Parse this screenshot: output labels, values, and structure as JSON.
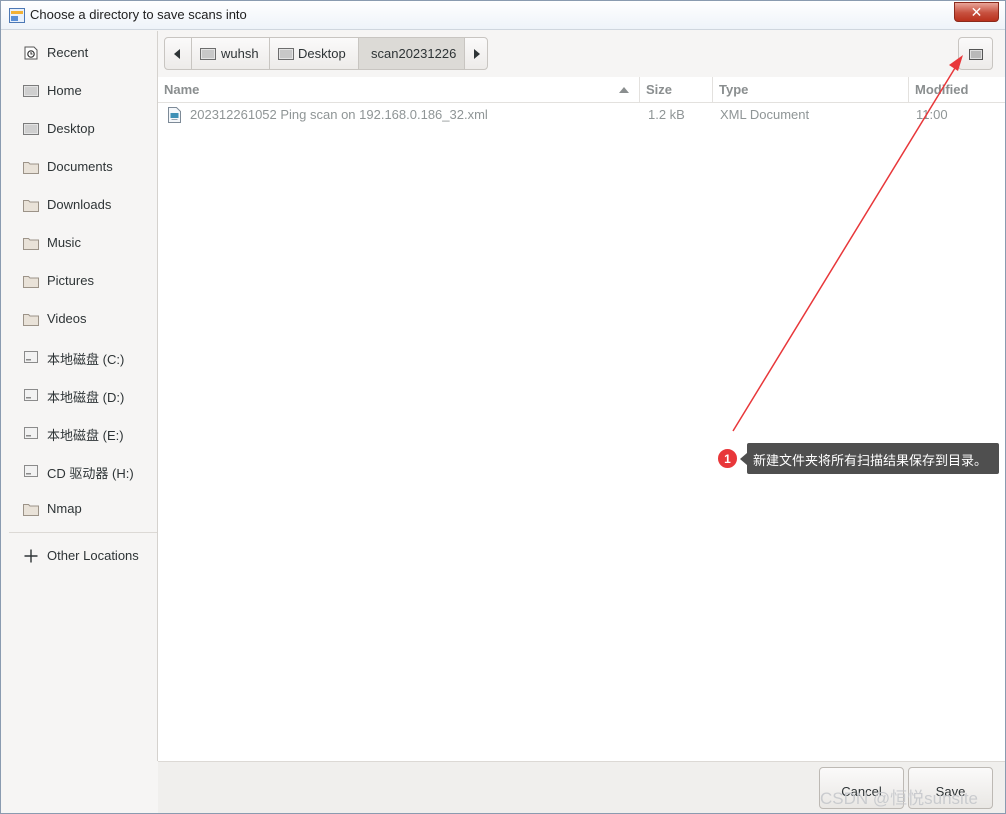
{
  "window": {
    "title": "Choose a directory to save scans into",
    "close_label": "✕"
  },
  "sidebar": {
    "items": [
      {
        "label": "Recent",
        "icon": "recent-icon"
      },
      {
        "label": "Home",
        "icon": "home-icon"
      },
      {
        "label": "Desktop",
        "icon": "desktop-icon"
      },
      {
        "label": "Documents",
        "icon": "folder-icon"
      },
      {
        "label": "Downloads",
        "icon": "folder-icon"
      },
      {
        "label": "Music",
        "icon": "folder-icon"
      },
      {
        "label": "Pictures",
        "icon": "folder-icon"
      },
      {
        "label": "Videos",
        "icon": "folder-icon"
      },
      {
        "label": "本地磁盘 (C:)",
        "icon": "drive-icon"
      },
      {
        "label": "本地磁盘 (D:)",
        "icon": "drive-icon"
      },
      {
        "label": "本地磁盘 (E:)",
        "icon": "drive-icon"
      },
      {
        "label": "CD 驱动器 (H:)",
        "icon": "drive-icon"
      },
      {
        "label": "Nmap",
        "icon": "folder-icon"
      }
    ],
    "other_locations": "Other Locations"
  },
  "pathbar": {
    "segments": [
      "wuhsh",
      "Desktop",
      "scan20231226"
    ],
    "active": "scan20231226"
  },
  "columns": {
    "name": "Name",
    "size": "Size",
    "type": "Type",
    "modified": "Modified"
  },
  "files": [
    {
      "name": "202312261052 Ping scan on 192.168.0.186_32.xml",
      "size": "1.2 kB",
      "type": "XML Document",
      "modified": "11:00"
    }
  ],
  "footer": {
    "cancel_label": "Cancel",
    "save_label": "Save"
  },
  "annotation": {
    "badge": "1",
    "text": "新建文件夹将所有扫描结果保存到目录。",
    "color": "#e8373a"
  },
  "watermark": "CSDN @恒悦sunsite"
}
